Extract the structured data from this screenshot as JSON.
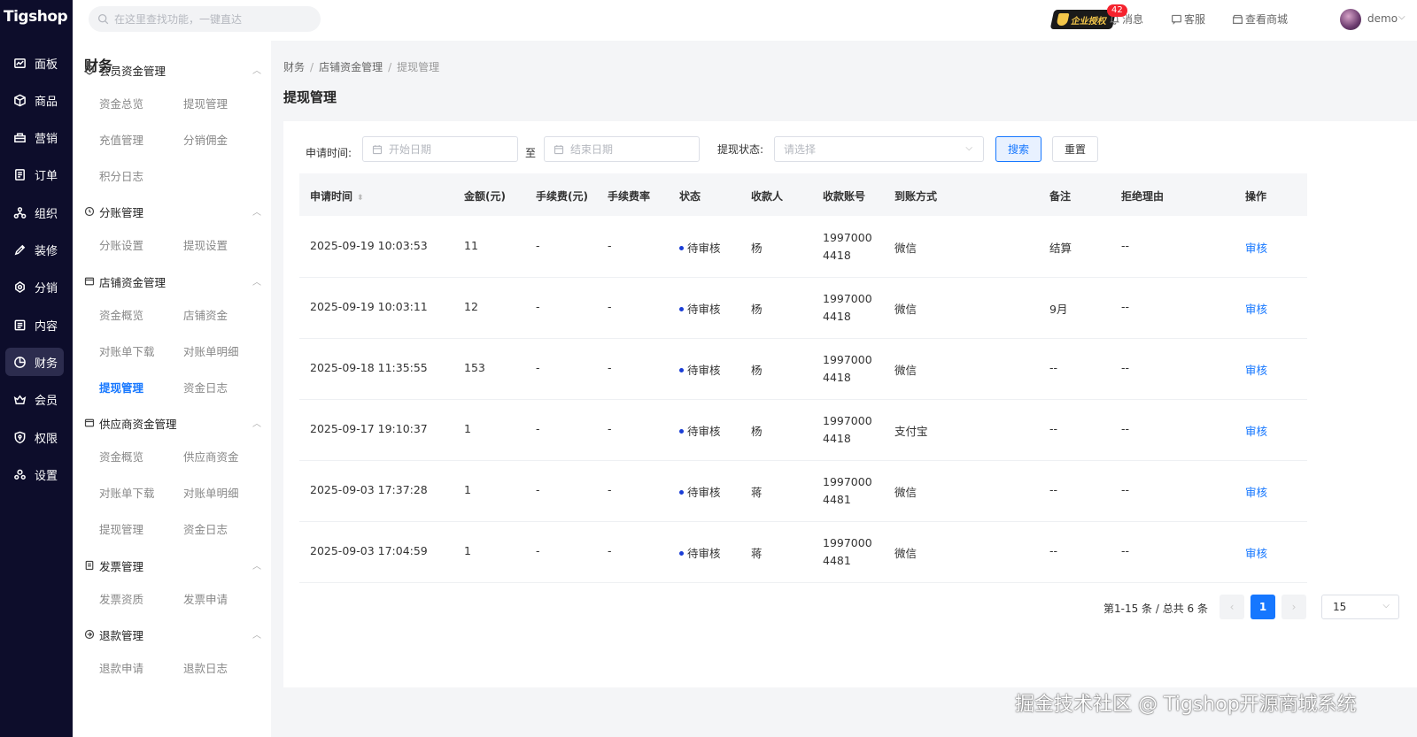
{
  "brand": {
    "logo": "Tigshop"
  },
  "rail": [
    {
      "label": "面板",
      "icon": "dashboard-icon"
    },
    {
      "label": "商品",
      "icon": "box-icon"
    },
    {
      "label": "营销",
      "icon": "marketing-icon"
    },
    {
      "label": "订单",
      "icon": "order-icon"
    },
    {
      "label": "组织",
      "icon": "org-icon"
    },
    {
      "label": "装修",
      "icon": "decor-icon"
    },
    {
      "label": "分销",
      "icon": "distribution-icon"
    },
    {
      "label": "内容",
      "icon": "content-icon"
    },
    {
      "label": "财务",
      "icon": "finance-icon",
      "active": true
    },
    {
      "label": "会员",
      "icon": "member-icon"
    },
    {
      "label": "权限",
      "icon": "permission-icon"
    },
    {
      "label": "设置",
      "icon": "settings-icon"
    }
  ],
  "header": {
    "search_placeholder": "在这里查找功能，一键直达",
    "vip_badge": "企业授权",
    "message_count": "42",
    "messages": "消息",
    "service": "客服",
    "view_store": "查看商城",
    "user": "demo"
  },
  "subnav": {
    "title": "财务",
    "groups": [
      {
        "label": "会员资金管理",
        "items": [
          "资金总览",
          "提现管理",
          "充值管理",
          "分销佣金",
          "积分日志"
        ]
      },
      {
        "label": "分账管理",
        "items": [
          "分账设置",
          "提现设置"
        ]
      },
      {
        "label": "店铺资金管理",
        "items": [
          "资金概览",
          "店铺资金",
          "对账单下载",
          "对账单明细",
          "提现管理",
          "资金日志"
        ]
      },
      {
        "label": "供应商资金管理",
        "items": [
          "资金概览",
          "供应商资金",
          "对账单下载",
          "对账单明细",
          "提现管理",
          "资金日志"
        ]
      },
      {
        "label": "发票管理",
        "items": [
          "发票资质",
          "发票申请"
        ]
      },
      {
        "label": "退款管理",
        "items": [
          "退款申请",
          "退款日志"
        ]
      }
    ]
  },
  "breadcrumb": [
    "财务",
    "店铺资金管理",
    "提现管理"
  ],
  "page_title": "提现管理",
  "filters": {
    "apply_time_label": "申请时间:",
    "start_placeholder": "开始日期",
    "to": "至",
    "end_placeholder": "结束日期",
    "status_label": "提现状态:",
    "status_placeholder": "请选择",
    "search_btn": "搜索",
    "reset_btn": "重置"
  },
  "table": {
    "headers": [
      "申请时间",
      "金额(元)",
      "手续费(元)",
      "手续费率",
      "状态",
      "收款人",
      "收款账号",
      "到账方式",
      "备注",
      "拒绝理由",
      "操作"
    ],
    "rows": [
      {
        "time": "2025-09-19 10:03:53",
        "amount": "11",
        "fee": "-",
        "rate": "-",
        "status": "待审核",
        "payee": "杨",
        "acct1": "1997000",
        "acct2": "4418",
        "method": "微信",
        "note": "结算",
        "reason": "--",
        "op": "审核"
      },
      {
        "time": "2025-09-19 10:03:11",
        "amount": "12",
        "fee": "-",
        "rate": "-",
        "status": "待审核",
        "payee": "杨",
        "acct1": "1997000",
        "acct2": "4418",
        "method": "微信",
        "note": "9月",
        "reason": "--",
        "op": "审核"
      },
      {
        "time": "2025-09-18 11:35:55",
        "amount": "153",
        "fee": "-",
        "rate": "-",
        "status": "待审核",
        "payee": "杨",
        "acct1": "1997000",
        "acct2": "4418",
        "method": "微信",
        "note": "--",
        "reason": "--",
        "op": "审核"
      },
      {
        "time": "2025-09-17 19:10:37",
        "amount": "1",
        "fee": "-",
        "rate": "-",
        "status": "待审核",
        "payee": "杨",
        "acct1": "1997000",
        "acct2": "4418",
        "method": "支付宝",
        "note": "--",
        "reason": "--",
        "op": "审核"
      },
      {
        "time": "2025-09-03 17:37:28",
        "amount": "1",
        "fee": "-",
        "rate": "-",
        "status": "待审核",
        "payee": "蒋",
        "acct1": "1997000",
        "acct2": "4481",
        "method": "微信",
        "note": "--",
        "reason": "--",
        "op": "审核"
      },
      {
        "time": "2025-09-03 17:04:59",
        "amount": "1",
        "fee": "-",
        "rate": "-",
        "status": "待审核",
        "payee": "蒋",
        "acct1": "1997000",
        "acct2": "4481",
        "method": "微信",
        "note": "--",
        "reason": "--",
        "op": "审核"
      }
    ]
  },
  "pagination": {
    "total": "第1-15 条 / 总共 6 条",
    "prev": "‹",
    "current": "1",
    "next": "›",
    "page_size": "15"
  },
  "watermark": "掘金技术社区 @ Tigshop开源商城系统",
  "colors": {
    "accent": "#1677ff",
    "rail_bg": "#0d0d2b",
    "status_dot": "#1a3dd6"
  }
}
